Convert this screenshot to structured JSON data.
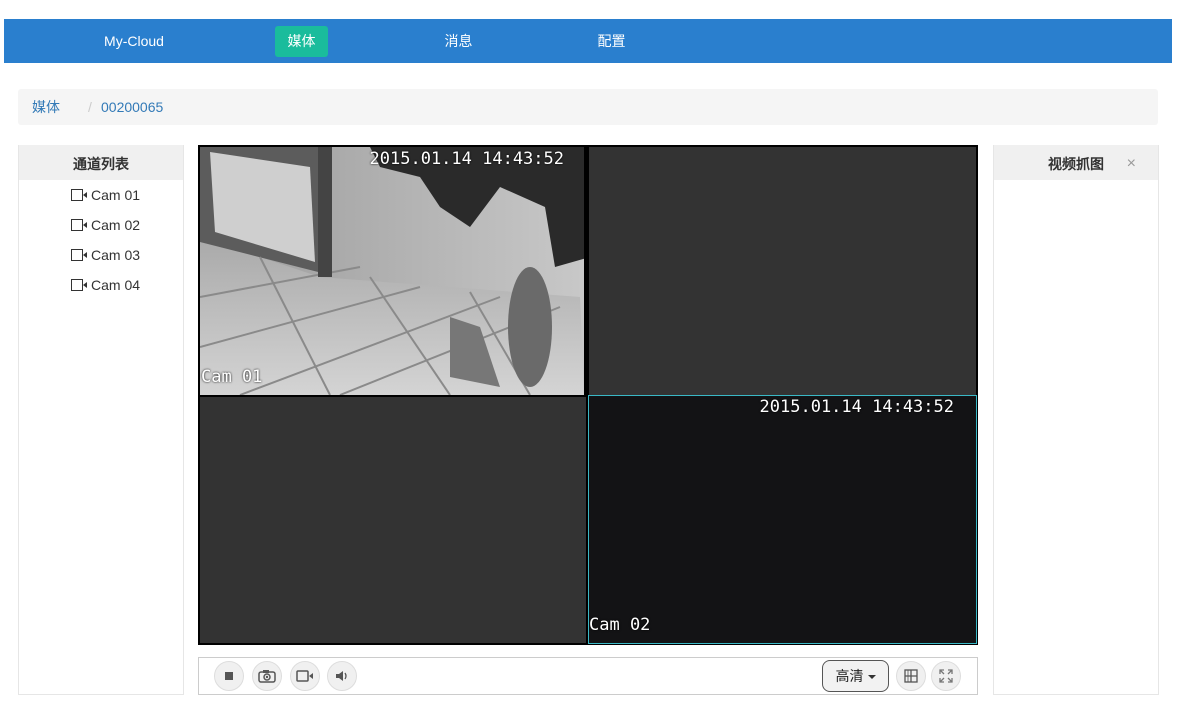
{
  "nav": {
    "brand": "My-Cloud",
    "items": [
      "媒体",
      "消息",
      "配置"
    ],
    "active": "媒体",
    "bar_color": "#2a7fce",
    "active_color": "#1abc9c"
  },
  "breadcrumb": {
    "root": "媒体",
    "separator": "/",
    "current": "00200065"
  },
  "channel_panel": {
    "title": "通道列表",
    "channels": [
      {
        "label": "Cam 01",
        "icon": "camera-icon"
      },
      {
        "label": "Cam 02",
        "icon": "camera-icon"
      },
      {
        "label": "Cam 03",
        "icon": "camera-icon"
      },
      {
        "label": "Cam 04",
        "icon": "camera-icon"
      }
    ]
  },
  "video": {
    "tiles": [
      {
        "timestamp": "2015.01.14 14:43:52",
        "camera": "Cam 01",
        "state": "live"
      },
      {
        "timestamp": "",
        "camera": "",
        "state": "empty"
      },
      {
        "timestamp": "",
        "camera": "",
        "state": "empty"
      },
      {
        "timestamp": "2015.01.14 14:43:52",
        "camera": "Cam 02",
        "state": "live-selected"
      }
    ],
    "selected_border_color": "#3ab9c6"
  },
  "controls": {
    "buttons": [
      "stop-icon",
      "snapshot-icon",
      "record-icon",
      "volume-icon",
      "layout-grid-icon",
      "fullscreen-icon"
    ],
    "quality": "高清"
  },
  "capture_panel": {
    "title": "视频抓图",
    "close": "×"
  }
}
